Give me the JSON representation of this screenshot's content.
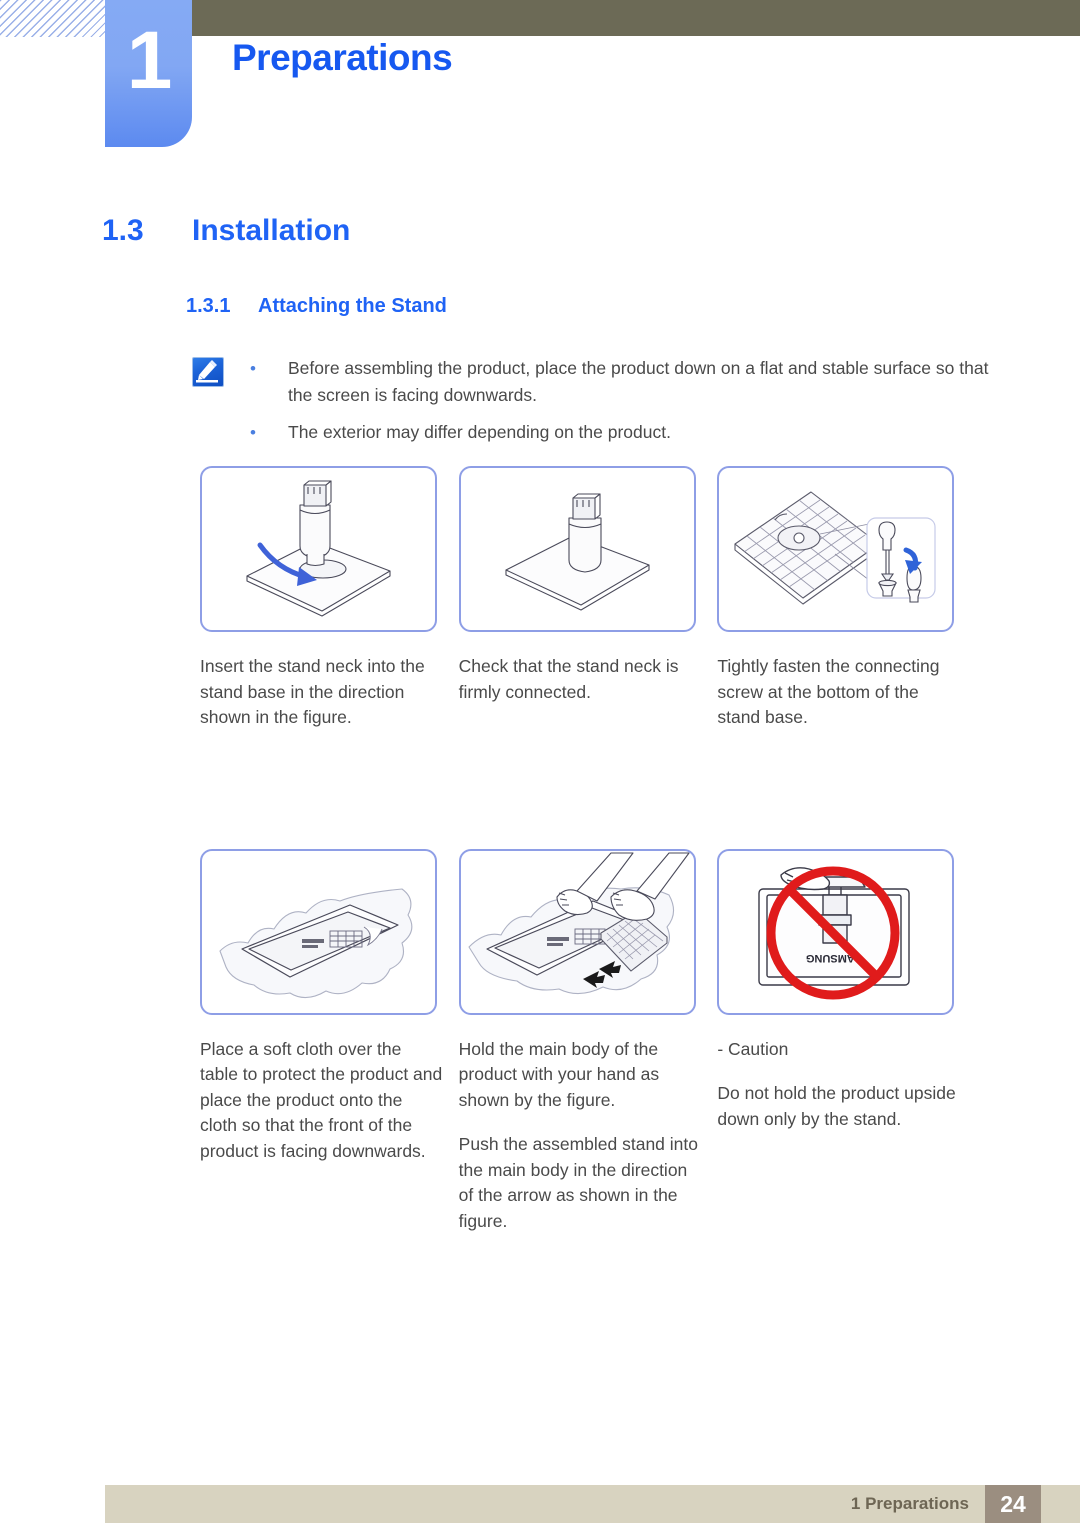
{
  "header": {
    "chapter_number": "1",
    "chapter_title": "Preparations"
  },
  "headings": {
    "h1_number": "1.3",
    "h1_text": "Installation",
    "h2_number": "1.3.1",
    "h2_text": "Attaching the Stand"
  },
  "note": {
    "icon": "note-pen-icon",
    "bullet": "•",
    "items": [
      "Before assembling the product, place the product down on a flat and stable surface so that the screen is facing downwards.",
      "The exterior may differ depending on the product."
    ]
  },
  "figures": {
    "row1": [
      {
        "illustration": "stand-neck-into-base-illustration",
        "caption": [
          "Insert the stand neck into the stand base in the direction shown in the figure."
        ]
      },
      {
        "illustration": "assembled-stand-illustration",
        "caption": [
          "Check that the stand neck is firmly connected."
        ]
      },
      {
        "illustration": "fasten-screw-illustration",
        "caption": [
          "Tightly fasten the connecting screw at the bottom of the stand base."
        ]
      }
    ],
    "row2": [
      {
        "illustration": "product-on-soft-cloth-illustration",
        "caption": [
          "Place a soft cloth over the table to protect the product and place the product onto the cloth so that the front of the product is facing downwards."
        ]
      },
      {
        "illustration": "attach-stand-to-body-illustration",
        "caption": [
          "Hold the main body of the product with your hand as shown by the figure.",
          "Push the assembled stand into the main body in the direction of the arrow as shown in the figure."
        ]
      },
      {
        "illustration": "do-not-hold-upside-down-illustration",
        "caption": [
          "- Caution",
          "Do not hold the product upside down only by the stand."
        ]
      }
    ]
  },
  "footer": {
    "label": "1 Preparations",
    "page_number": "24"
  },
  "colors": {
    "accent_blue": "#1f63f5",
    "tab_blue": "#82a7f3",
    "olive": "#6c6a56",
    "footer_beige": "#d8d3c0",
    "footer_page_box": "#9b8e80",
    "figure_border": "#8e9ee6",
    "caution_red": "#e01b1b"
  }
}
